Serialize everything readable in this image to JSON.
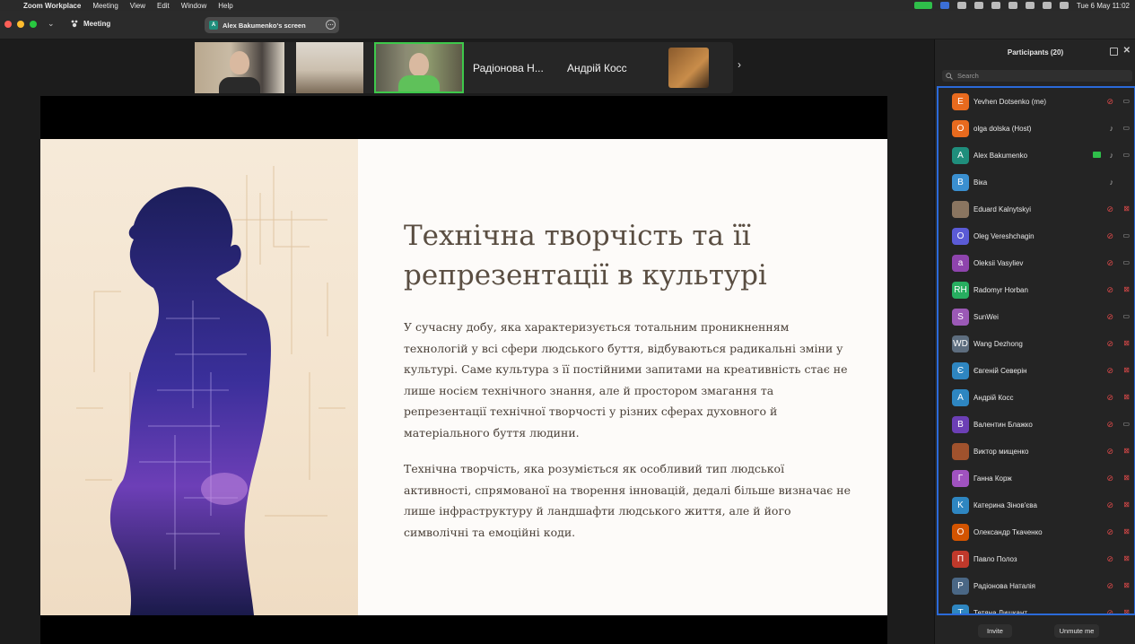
{
  "menubar": {
    "app": "Zoom Workplace",
    "items": [
      "Meeting",
      "View",
      "Edit",
      "Window",
      "Help"
    ],
    "clock": "Tue 6 May  11:02"
  },
  "window": {
    "meeting_label": "Meeting",
    "share_label": "Alex Bakumenko's screen",
    "share_initial": "A"
  },
  "gallery": {
    "tiles": [
      "Радіонова Н...",
      "Андрій Косс"
    ],
    "active_speaker_color": "#3ec84b"
  },
  "slide": {
    "title_line1": "Технічна творчість та її",
    "title_line2": "репрезентації в культурі",
    "paragraph1": "У сучасну добу, яка характеризується тотальним проникненням технологій у всі сфери людського буття, відбуваються радикальні зміни у культурі. Саме культура з її постійними запитами на креативність стає не лише носієм технічного знання, але й простором змагання та репрезентації технічної творчості у різних сферах духовного й матеріального буття людини.",
    "paragraph2": "Технічна творчість, яка розуміється як особливий тип людської активності, спрямованої на творення інновацій, дедалі більше визначає не лише інфраструктуру й ландшафти людського життя, але й його символічні та емоційні коди."
  },
  "participants": {
    "title": "Participants (20)",
    "search_placeholder": "Search",
    "list": [
      {
        "initial": "E",
        "name": "Yevhen Dotsenko (me)",
        "color": "#e86a1e",
        "mic": "muted",
        "cam": "on"
      },
      {
        "initial": "O",
        "name": "olga dolska (Host)",
        "color": "#e86a1e",
        "mic": "on",
        "cam": "on"
      },
      {
        "initial": "A",
        "name": "Alex Bakumenko",
        "color": "#1f8e7c",
        "mic": "on",
        "cam": "on",
        "sharing": true
      },
      {
        "initial": "B",
        "name": "Віка",
        "color": "#3a8fd0",
        "mic": "on",
        "cam": "none"
      },
      {
        "initial": "",
        "name": "Eduard Kalnytskyi",
        "color": "#8a7560",
        "mic": "muted",
        "cam": "off"
      },
      {
        "initial": "O",
        "name": "Oleg Vereshchagin",
        "color": "#5b5bd6",
        "mic": "muted",
        "cam": "on"
      },
      {
        "initial": "a",
        "name": "Oleksii Vasyliev",
        "color": "#8e44ad",
        "mic": "muted",
        "cam": "on"
      },
      {
        "initial": "RH",
        "name": "Radomyr Horban",
        "color": "#27ae60",
        "mic": "muted",
        "cam": "off"
      },
      {
        "initial": "S",
        "name": "SunWei",
        "color": "#9b59b6",
        "mic": "muted",
        "cam": "on"
      },
      {
        "initial": "WD",
        "name": "Wang Dezhong",
        "color": "#5d6d7e",
        "mic": "muted",
        "cam": "off"
      },
      {
        "initial": "Є",
        "name": "Євгеній Северін",
        "color": "#2e86c1",
        "mic": "muted",
        "cam": "off"
      },
      {
        "initial": "A",
        "name": "Андрій Косс",
        "color": "#2e86c1",
        "mic": "muted",
        "cam": "off"
      },
      {
        "initial": "B",
        "name": "Валентин Блажко",
        "color": "#6c3fb5",
        "mic": "muted",
        "cam": "on"
      },
      {
        "initial": "",
        "name": "Виктор мищенко",
        "color": "#a0522d",
        "mic": "muted",
        "cam": "off"
      },
      {
        "initial": "Г",
        "name": "Ганна Корж",
        "color": "#a052c0",
        "mic": "muted",
        "cam": "off"
      },
      {
        "initial": "K",
        "name": "Катерина Зінов'єва",
        "color": "#2e86c1",
        "mic": "muted",
        "cam": "off"
      },
      {
        "initial": "O",
        "name": "Олександр Ткаченко",
        "color": "#d35400",
        "mic": "muted",
        "cam": "off"
      },
      {
        "initial": "П",
        "name": "Павло Полоз",
        "color": "#c0392b",
        "mic": "muted",
        "cam": "off"
      },
      {
        "initial": "P",
        "name": "Радіонова Наталія",
        "color": "#4a6785",
        "mic": "muted",
        "cam": "off"
      },
      {
        "initial": "T",
        "name": "Тетяна Лишкант",
        "color": "#2e86c1",
        "mic": "muted",
        "cam": "off"
      }
    ],
    "invite_label": "Invite",
    "unmute_label": "Unmute me"
  }
}
